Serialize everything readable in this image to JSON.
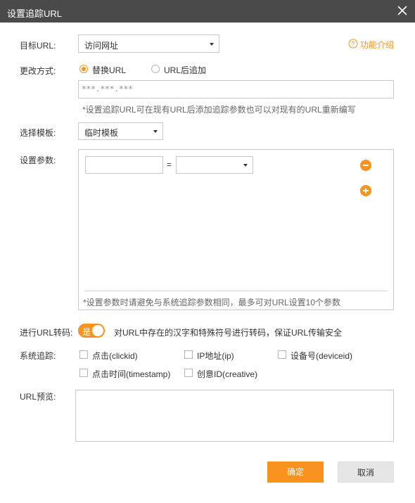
{
  "dialog": {
    "title": "设置追踪URL"
  },
  "target_url": {
    "label": "目标URL:",
    "selected": "访问网址"
  },
  "help": {
    "label": "功能介绍"
  },
  "change_mode": {
    "label": "更改方式:",
    "option_replace": "替换URL",
    "option_append": "URL后追加",
    "selected": "替换URL"
  },
  "url_input": {
    "value": "***.***.***"
  },
  "url_hint": "*设置追踪URL可在现有URL后添加追踪参数也可以对现有的URL重新编写",
  "template": {
    "label": "选择模板:",
    "selected": "临时模板"
  },
  "params": {
    "label": "设置参数:",
    "equals": "=",
    "name_value": "",
    "value_selected": "",
    "hint": "*设置参数时请避免与系统追踪参数相同，最多可对URL设置10个参数"
  },
  "transcode": {
    "label": "进行URL转码:",
    "toggle_label": "是",
    "toggle_on": true,
    "description": "对URL中存在的汉字和特殊符号进行转码，保证URL传输安全"
  },
  "system_tracking": {
    "label": "系统追踪:",
    "options": [
      {
        "label": "点击(clickid)",
        "checked": false
      },
      {
        "label": "IP地址(ip)",
        "checked": false
      },
      {
        "label": "设备号(deviceid)",
        "checked": false
      },
      {
        "label": "点击时间(timestamp)",
        "checked": false
      },
      {
        "label": "创意ID(creative)",
        "checked": false
      }
    ]
  },
  "preview": {
    "label": "URL预览:",
    "value": ""
  },
  "buttons": {
    "confirm": "确定",
    "cancel": "取消"
  },
  "colors": {
    "accent": "#f7931e",
    "titlebar": "#4a4a4a",
    "cancel_bg": "#e6e6e6"
  },
  "icons": {
    "close": "close-icon",
    "help": "question-circle-icon",
    "remove": "minus-circle-icon",
    "add": "plus-circle-icon"
  }
}
